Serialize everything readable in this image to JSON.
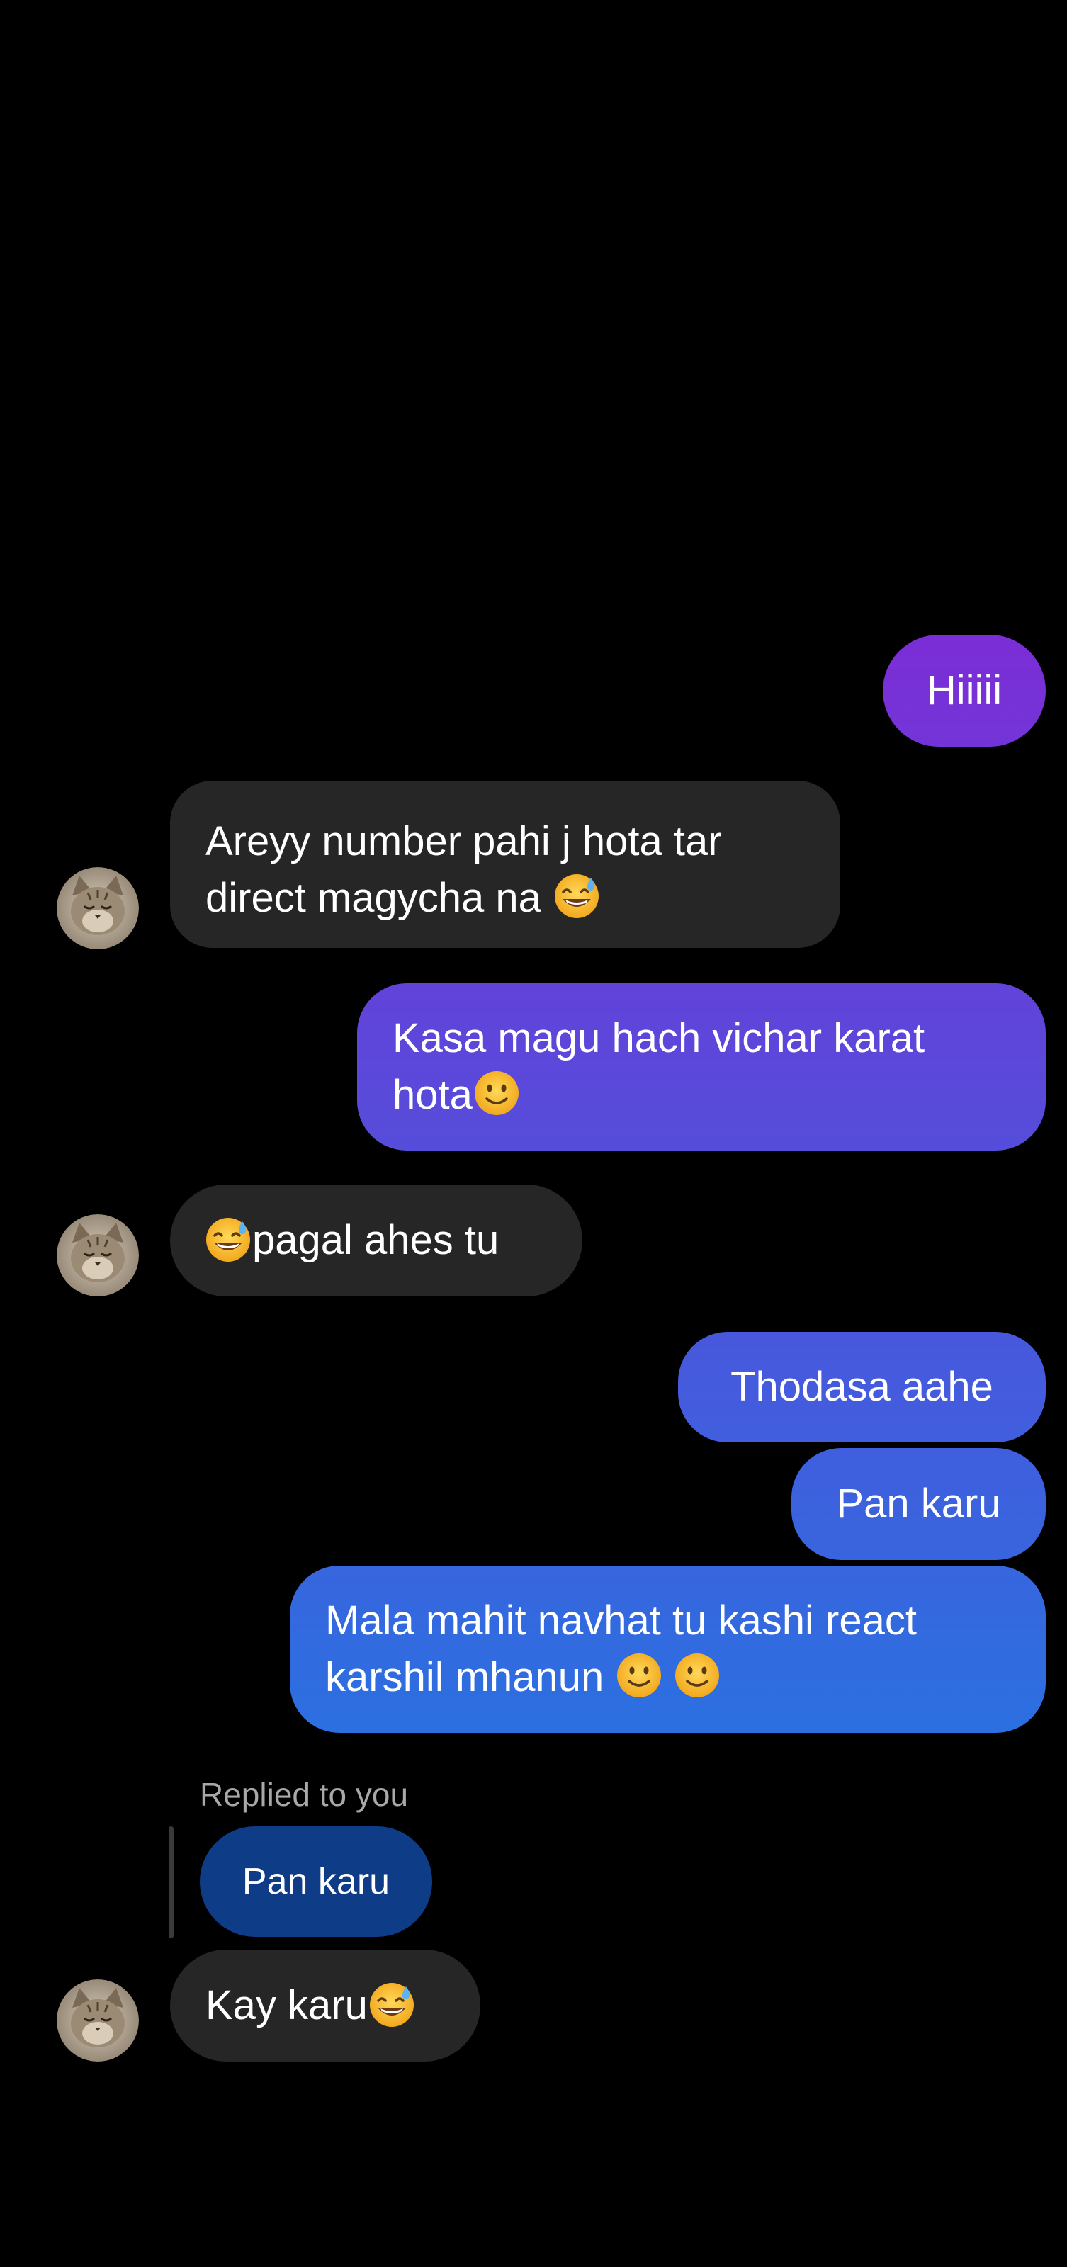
{
  "messages": [
    {
      "id": "m1",
      "sender": "me",
      "lines": [
        "Hiiiii"
      ]
    },
    {
      "id": "m2",
      "sender": "them",
      "lines": [
        "Areyy number pahi j hota tar",
        "direct magycha na"
      ],
      "emoji": "grinning-sweat"
    },
    {
      "id": "m3",
      "sender": "me",
      "lines": [
        "Kasa magu hach vichar karat",
        "hota"
      ],
      "emoji": "slightly-smiling"
    },
    {
      "id": "m4",
      "sender": "them",
      "text": "pagal ahes tu",
      "emoji": "grinning-sweat"
    },
    {
      "id": "m5",
      "sender": "me",
      "text": "Thodasa aahe"
    },
    {
      "id": "m6",
      "sender": "me",
      "text": "Pan karu"
    },
    {
      "id": "m7",
      "sender": "me",
      "lines": [
        "Mala mahit navhat tu kashi react",
        "karshil mhanun"
      ],
      "emoji": "slightly-smiling x2"
    },
    {
      "id": "m8",
      "sender": "them",
      "reply_label": "Replied to you",
      "quoted_text": "Pan karu",
      "text": "Kay karu",
      "emoji": "grinning-sweat"
    }
  ],
  "colors": {
    "background": "#000000",
    "incoming_bubble": "#262626",
    "outgoing_gradient_top": "#7b2ed6",
    "outgoing_gradient_bottom": "#2c6fe0",
    "reply_quote_bubble": "#0f3c87",
    "reply_label": "#a8a8a8"
  },
  "avatar": {
    "icon": "cat-avatar-icon"
  }
}
